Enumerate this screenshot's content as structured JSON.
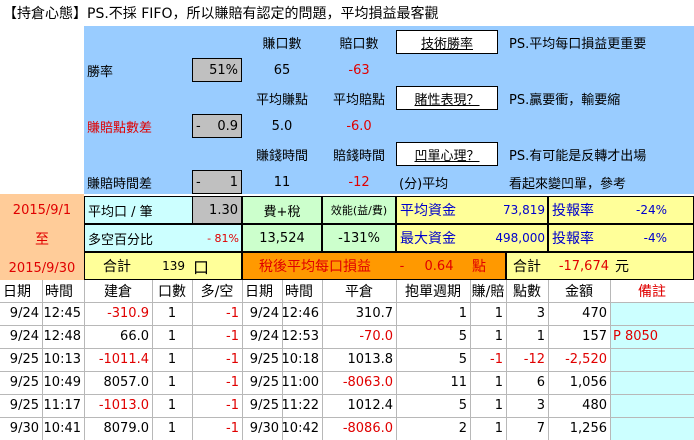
{
  "title": "【持倉心態】PS.不採 FIFO，所以賺賠有認定的問題，平均損益最客觀",
  "header": {
    "win_count_label": "賺口數",
    "loss_count_label": "賠口數",
    "tech_win_rate_link": "技術勝率",
    "note_1": "PS.平均每口損益更重要",
    "win_rate_label": "勝率",
    "win_rate_value": "51%",
    "win_count": "65",
    "loss_count": "-63",
    "avg_win_pts_label": "平均賺點",
    "avg_loss_pts_label": "平均賠點",
    "gamble_link": "賭性表現？",
    "note_2": "PS.贏要衝，輸要縮",
    "pts_diff_label": "賺賠點數差",
    "pts_diff_sign": "-",
    "pts_diff_value": "0.9",
    "avg_win_pts": "5.0",
    "avg_loss_pts": "-6.0",
    "win_time_label": "賺錢時間",
    "loss_time_label": "賠錢時間",
    "concave_link": "凹單心理？",
    "note_3": "PS.有可能是反轉才出場",
    "time_diff_label": "賺賠時間差",
    "time_diff_sign": "-",
    "time_diff_value": "1",
    "win_time": "11",
    "loss_time": "-12",
    "avg_min_label": "(分)平均",
    "note_4": "看起來變凹單，參考"
  },
  "summary": {
    "date_start": "2015/9/1",
    "date_to": "至",
    "date_end": "2015/9/30",
    "avg_per_lot_label": "平均口 / 筆",
    "avg_per_lot": "1.30",
    "fee_tax_label": "費+稅",
    "efficiency_label": "效能(益/費)",
    "avg_capital_label": "平均資金",
    "avg_capital": "73,819",
    "roi_label_1": "投報率",
    "roi_1": "-24%",
    "long_short_label": "多空百分比",
    "long_short_value": "- 81%",
    "fee_tax": "13,524",
    "efficiency": "-131%",
    "max_capital_label": "最大資金",
    "max_capital": "498,000",
    "roi_label_2": "投報率",
    "roi_2": "-4%",
    "total_label": "合計",
    "total_lots": "139",
    "lots_unit": "口",
    "after_tax_label": "稅後平均每口損益",
    "after_tax_sign": "-",
    "after_tax_value": "0.64",
    "pts_unit": "點",
    "total_label_2": "合計",
    "total_amount": "-17,674",
    "currency_unit": "元"
  },
  "table": {
    "headers": [
      "日期",
      "時間",
      "建倉",
      "口數",
      "多/空",
      "日期",
      "時間",
      "平倉",
      "抱單週期",
      "賺/賠",
      "點數",
      "金額",
      "備註"
    ],
    "rows": [
      {
        "d1": "9/24",
        "t1": "12:45",
        "open": "-310.9",
        "lots": "1",
        "side": "-1",
        "d2": "9/24",
        "t2": "12:46",
        "close": "310.7",
        "period": "1",
        "wl": "1",
        "pts": "3",
        "amt": "470",
        "note": ""
      },
      {
        "d1": "9/24",
        "t1": "12:48",
        "open": "66.0",
        "lots": "1",
        "side": "-1",
        "d2": "9/24",
        "t2": "12:53",
        "close": "-70.0",
        "period": "5",
        "wl": "1",
        "pts": "1",
        "amt": "157",
        "note": "P 8050"
      },
      {
        "d1": "9/25",
        "t1": "10:13",
        "open": "-1011.4",
        "lots": "1",
        "side": "-1",
        "d2": "9/25",
        "t2": "10:18",
        "close": "1013.8",
        "period": "5",
        "wl": "-1",
        "pts": "-12",
        "amt": "-2,520",
        "note": ""
      },
      {
        "d1": "9/25",
        "t1": "10:49",
        "open": "8057.0",
        "lots": "1",
        "side": "-1",
        "d2": "9/25",
        "t2": "11:00",
        "close": "-8063.0",
        "period": "11",
        "wl": "1",
        "pts": "6",
        "amt": "1,056",
        "note": ""
      },
      {
        "d1": "9/25",
        "t1": "11:17",
        "open": "-1013.0",
        "lots": "1",
        "side": "-1",
        "d2": "9/25",
        "t2": "11:22",
        "close": "1012.4",
        "period": "5",
        "wl": "1",
        "pts": "3",
        "amt": "480",
        "note": ""
      },
      {
        "d1": "9/30",
        "t1": "10:41",
        "open": "8079.0",
        "lots": "1",
        "side": "-1",
        "d2": "9/30",
        "t2": "10:42",
        "close": "-8086.0",
        "period": "2",
        "wl": "1",
        "pts": "7",
        "amt": "1,256",
        "note": ""
      }
    ]
  },
  "colors": {
    "light_blue": "#99ccff",
    "cyan_band": "#ccffff",
    "gray": "#c0c0c0",
    "pale_yellow": "#ffff99",
    "peach": "#ffcc99",
    "orange": "#ff9900",
    "green": "#ccffcc",
    "red_text": "#e00000"
  }
}
